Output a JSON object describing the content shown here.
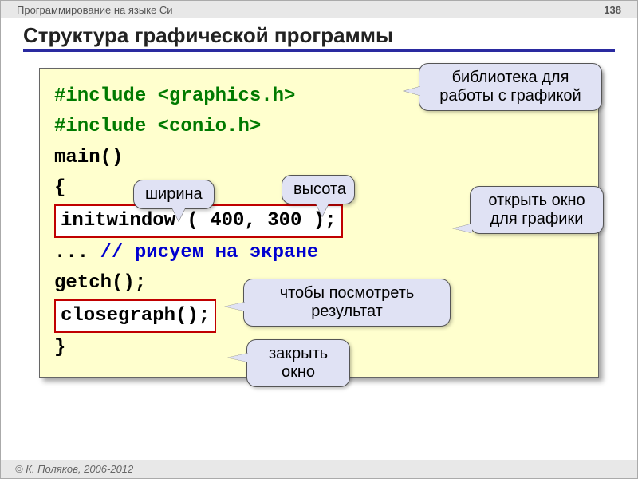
{
  "header": {
    "context": "Программирование на языке Си",
    "page": "138"
  },
  "title": "Структура графической программы",
  "code": {
    "include1_pre": "#include ",
    "include1_hdr": "<graphics.h>",
    "include2_pre": "#include ",
    "include2_hdr": "<conio.h>",
    "main": "main()",
    "brace_open": "{",
    "initwindow": "initwindow ( 400, 300 );",
    "draw_dots": "... ",
    "draw_comment": "// рисуем на экране",
    "getch": "getch();",
    "closegraph": "closegraph();",
    "brace_close": "}"
  },
  "callouts": {
    "lib": "библиотека для работы с графикой",
    "width": "ширина",
    "height": "высота",
    "open": "открыть окно для графики",
    "result": "чтобы посмотреть результат",
    "close": "закрыть окно"
  },
  "footer": "© К. Поляков, 2006-2012"
}
